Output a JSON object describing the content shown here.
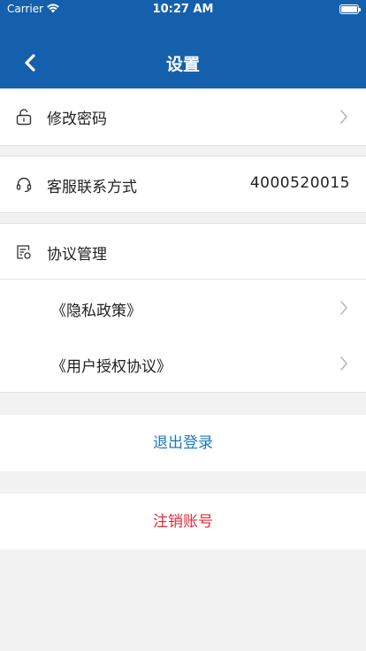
{
  "status_bar": {
    "carrier": "Carrier",
    "time": "10:27 AM",
    "battery_level": 1.0
  },
  "nav": {
    "title": "设置",
    "back_icon": "chevron-left-icon",
    "color": "#1560ad"
  },
  "settings": {
    "change_password": {
      "label": "修改密码",
      "icon": "lock-icon"
    },
    "customer_service": {
      "label": "客服联系方式",
      "value": "4000520015",
      "icon": "headset-icon"
    },
    "agreements": {
      "label": "协议管理",
      "icon": "document-icon",
      "items": [
        {
          "label": "《隐私政策》"
        },
        {
          "label": "《用户授权协议》"
        }
      ]
    }
  },
  "actions": {
    "logout": {
      "label": "退出登录",
      "color": "#1b78c2"
    },
    "delete_account": {
      "label": "注销账号",
      "color": "#e02b3a"
    }
  }
}
